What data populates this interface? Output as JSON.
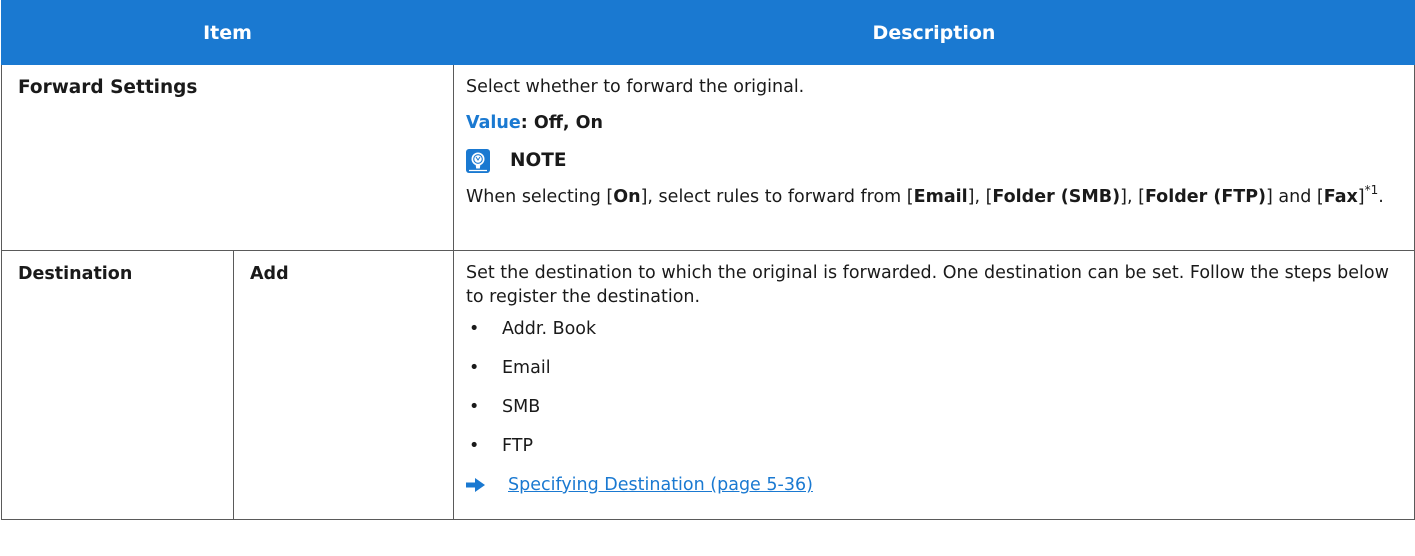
{
  "header": {
    "item": "Item",
    "description": "Description"
  },
  "forward_settings": {
    "label": "Forward Settings",
    "desc": "Select whether to forward the original.",
    "value_label": "Value",
    "value_text": ": Off, On",
    "note_title": "NOTE",
    "note": {
      "t1": "When selecting [",
      "on": "On",
      "t2": "], select rules to forward from [",
      "email": "Email",
      "t3": "], [",
      "folder_smb": "Folder (SMB)",
      "t4": "], [",
      "folder_ftp": "Folder (FTP)",
      "t5": "] and [",
      "fax": "Fax",
      "t6": "]",
      "sup": "*1",
      "t7": "."
    }
  },
  "destination": {
    "label": "Destination",
    "sub_label": "Add",
    "desc": "Set the destination to which the original is forwarded. One destination can be set. Follow the steps below to register the destination.",
    "bullet_char": "•",
    "items": [
      "Addr. Book",
      "Email",
      "SMB",
      "FTP"
    ],
    "link": "Specifying Destination (page 5-36)"
  },
  "colors": {
    "accent": "#1a79d1",
    "border": "#5a5a5a"
  },
  "icons": {
    "note": "note-bulb-icon",
    "link": "right-arrow-icon"
  }
}
